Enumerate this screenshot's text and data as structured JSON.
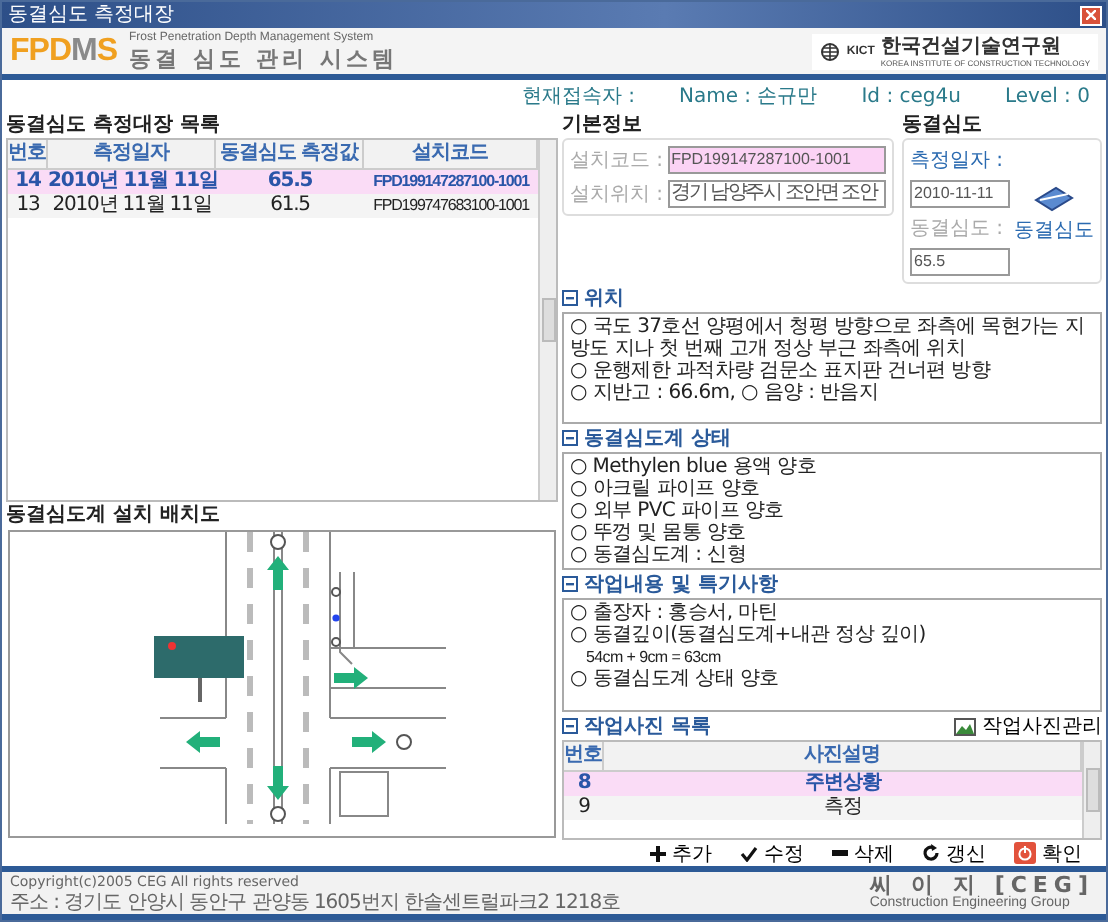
{
  "window": {
    "title": "동결심도 측정대장"
  },
  "header": {
    "logo_parts": [
      {
        "text": "F",
        "color": "#f0a020"
      },
      {
        "text": "P",
        "color": "#f0a020"
      },
      {
        "text": "D",
        "color": "#f0a020"
      },
      {
        "text": "M",
        "color": "#8a8a8a"
      },
      {
        "text": "S",
        "color": "#f0a020"
      }
    ],
    "subtitle": "Frost Penetration Depth Management System",
    "title": "동결 심도 관리 시스템",
    "org_abbr": "KICT",
    "org_name": "한국건설기술연구원",
    "org_subtitle": "KOREA INSTITUTE OF CONSTRUCTION TECHNOLOGY"
  },
  "user": {
    "label": "현재접속자 :",
    "name_label": "Name :",
    "name": "손규만",
    "id_label": "Id :",
    "id": "ceg4u",
    "level_label": "Level :",
    "level": "0"
  },
  "list": {
    "title": "동결심도 측정대장 목록",
    "columns": [
      "번호",
      "측정일자",
      "동결심도 측정값",
      "설치코드"
    ],
    "rows": [
      {
        "cells": [
          "14",
          "2010년 11월 11일",
          "65.5",
          "FPD199147287100-1001"
        ],
        "selected": true
      },
      {
        "cells": [
          "13",
          "2010년 11월 11일",
          "61.5",
          "FPD199747683100-1001"
        ],
        "selected": false
      }
    ]
  },
  "layout": {
    "title": "동결심도계 설치 배치도"
  },
  "basic_info": {
    "title": "기본정보",
    "fields": [
      {
        "label": "설치코드 :",
        "value": "FPD199147287100-1001",
        "highlighted": true
      },
      {
        "label": "설치위치 :",
        "value": "경기 남양주시 조안면 조안",
        "highlighted": false
      }
    ]
  },
  "frost": {
    "title": "동결심도",
    "date_label": "측정일자 :",
    "date": "2010-11-11",
    "depth_label": "동결심도 :",
    "depth": "65.5",
    "button": "동결심도"
  },
  "sections": [
    {
      "title": "위치",
      "lines": [
        {
          "text": "○ 국도 37호선 양평에서 청평 방향으로 좌측에 목현가는 지방도 지나 첫 번째 고개 정상 부근 좌측에 위치",
          "kind": "item"
        },
        {
          "text": "○ 운행제한 과적차량 검문소 표지판 건너편 방향",
          "kind": "item"
        },
        {
          "text": "○ 지반고 : 66.6m,  ○ 음양 : 반음지",
          "kind": "item"
        }
      ]
    },
    {
      "title": "동결심도계 상태",
      "lines": [
        {
          "text": "○ Methylen blue 용액 양호",
          "kind": "item"
        },
        {
          "text": "○ 아크릴 파이프 양호",
          "kind": "item"
        },
        {
          "text": "○ 외부 PVC 파이프 양호",
          "kind": "item"
        },
        {
          "text": "○ 뚜껑 및 몸통 양호",
          "kind": "item"
        },
        {
          "text": "○ 동결심도계 : 신형",
          "kind": "item"
        }
      ]
    },
    {
      "title": "작업내용 및 특기사항",
      "lines": [
        {
          "text": "○ 출장자 : 홍승서, 마틴",
          "kind": "item"
        },
        {
          "text": "○ 동결깊이(동결심도계+내관 정상 깊이)",
          "kind": "item"
        },
        {
          "text": "54cm + 9cm = 63cm",
          "kind": "note"
        },
        {
          "text": "○ 동결심도계 상태 양호",
          "kind": "item"
        }
      ]
    }
  ],
  "photos": {
    "title": "작업사진 목록",
    "manage_button": "작업사진관리",
    "columns": [
      "번호",
      "사진설명"
    ],
    "rows": [
      {
        "cells": [
          "8",
          "주변상황"
        ],
        "selected": true
      },
      {
        "cells": [
          "9",
          "측정"
        ],
        "selected": false
      }
    ]
  },
  "actions": [
    {
      "label": "추가",
      "kind": "add"
    },
    {
      "label": "수정",
      "kind": "edit"
    },
    {
      "label": "삭제",
      "kind": "delete"
    },
    {
      "label": "갱신",
      "kind": "refresh"
    },
    {
      "label": "확인",
      "kind": "confirm"
    }
  ],
  "footer": {
    "copyright": "Copyright(c)2005 CEG All rights reserved",
    "address": "주소 : 경기도 안양시 동안구 관양동 1605번지 한솔센트럴파크2 1218호",
    "company": "씨 이 지 [CEG]",
    "company_en": "Construction Engineering Group"
  }
}
